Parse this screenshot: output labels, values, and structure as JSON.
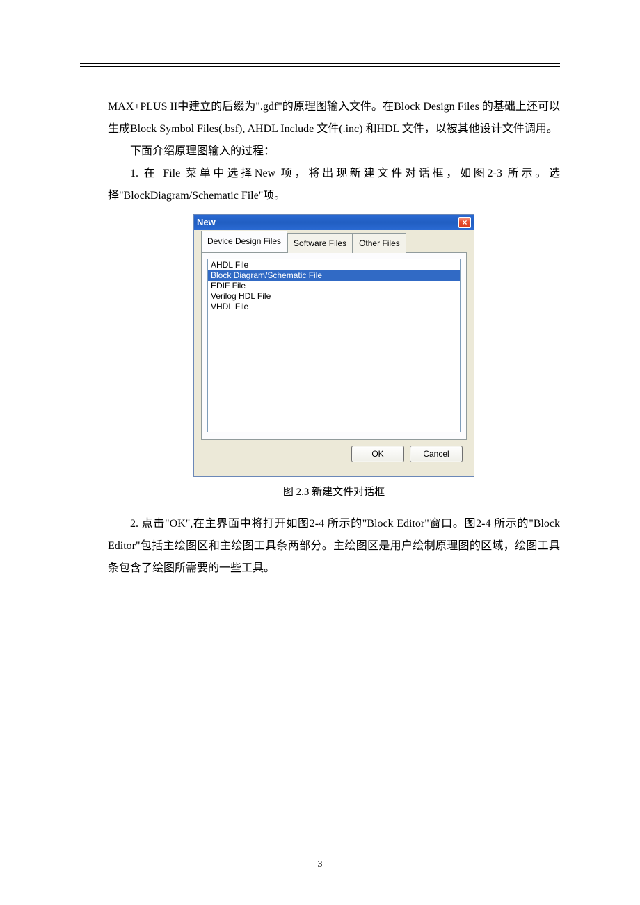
{
  "para1": "MAX+PLUS II中建立的后缀为\".gdf\"的原理图输入文件。在Block Design Files 的基础上还可以生成Block Symbol Files(.bsf), AHDL Include 文件(.inc) 和HDL 文件，以被其他设计文件调用。",
  "para2": "下面介绍原理图输入的过程：",
  "para3": "1. 在 File 菜单中选择New 项，将出现新建文件对话框，如图2-3 所示。选择\"BlockDiagram/Schematic File\"项。",
  "dialog": {
    "title": "New",
    "close": "×",
    "tabs": [
      "Device Design Files",
      "Software Files",
      "Other Files"
    ],
    "list": [
      "AHDL File",
      "Block Diagram/Schematic File",
      "EDIF File",
      "Verilog HDL File",
      "VHDL File"
    ],
    "selected_index": 1,
    "ok": "OK",
    "cancel": "Cancel"
  },
  "caption": "图 2.3 新建文件对话框",
  "para4": "2. 点击\"OK\",在主界面中将打开如图2-4 所示的\"Block Editor\"窗口。图2-4 所示的\"Block Editor\"包括主绘图区和主绘图工具条两部分。主绘图区是用户绘制原理图的区域，绘图工具条包含了绘图所需要的一些工具。",
  "page_number": "3"
}
